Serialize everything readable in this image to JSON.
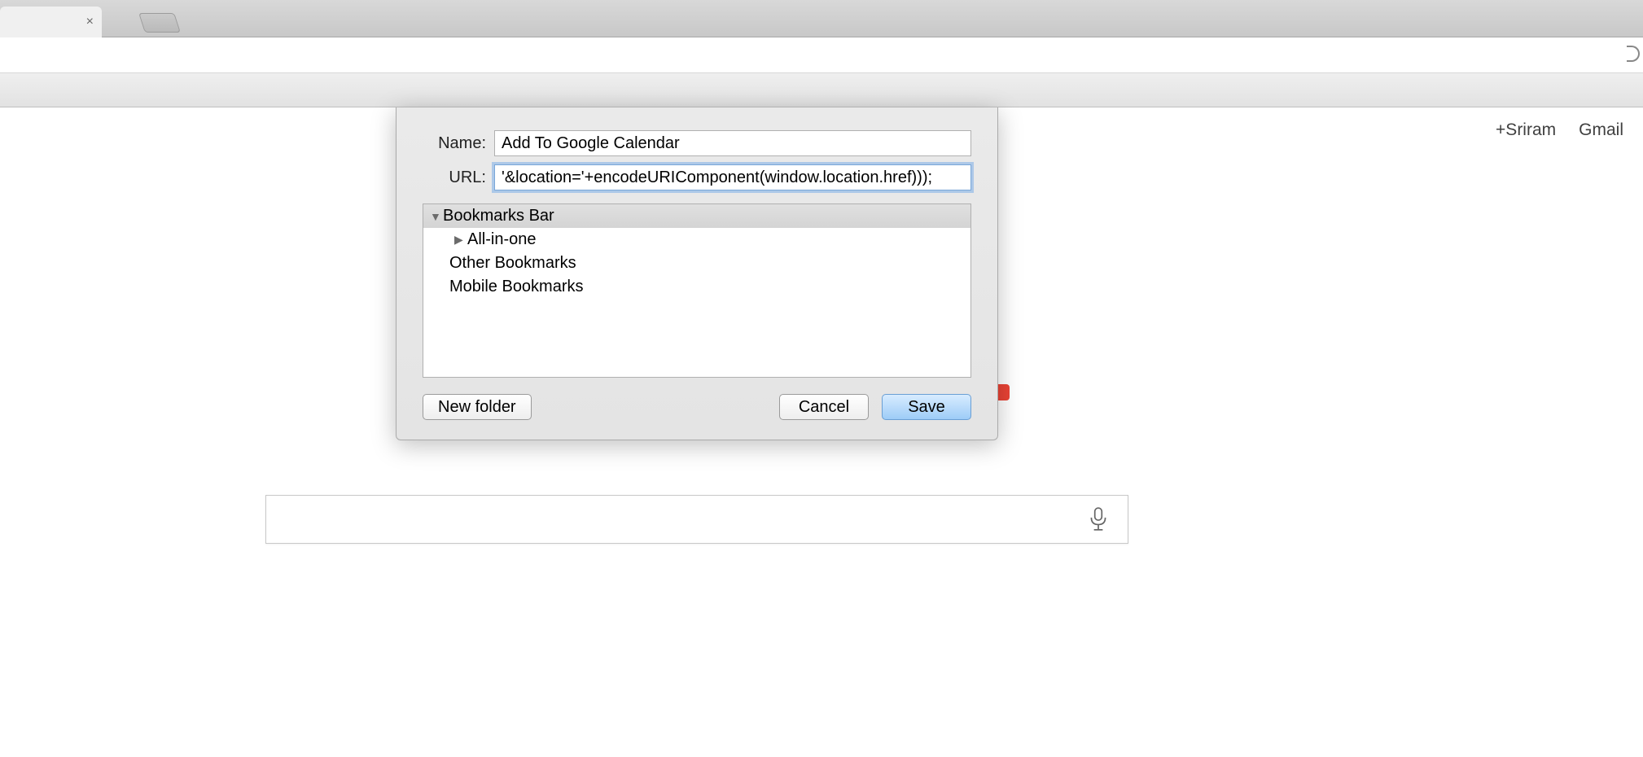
{
  "dialog": {
    "labels": {
      "name": "Name:",
      "url": "URL:"
    },
    "fields": {
      "name_value": "Add To Google Calendar",
      "url_value": "'&location='+encodeURIComponent(window.location.href)));"
    },
    "folders": {
      "root": "Bookmarks Bar",
      "child": "All-in-one",
      "other": "Other Bookmarks",
      "mobile": "Mobile Bookmarks"
    },
    "buttons": {
      "new_folder": "New folder",
      "cancel": "Cancel",
      "save": "Save"
    }
  },
  "top_links": {
    "plus_user": "+Sriram",
    "gmail": "Gmail"
  },
  "search": {
    "value": ""
  }
}
